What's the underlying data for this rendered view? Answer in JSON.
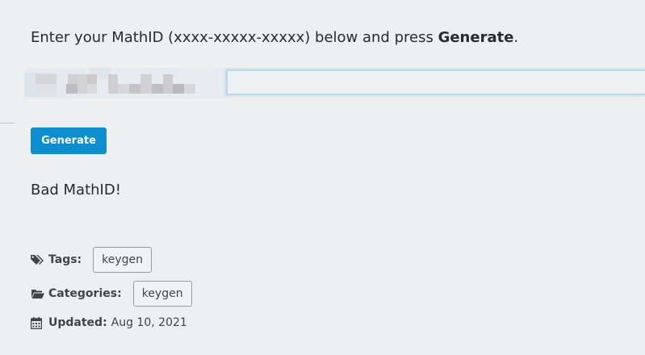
{
  "instruction": {
    "prefix": "Enter your MathID (xxxx-xxxxx-xxxxx) below and press ",
    "emphasis": "Generate",
    "suffix": "."
  },
  "mathid_input": {
    "value": "",
    "placeholder": ""
  },
  "generate_button": {
    "label": "Generate",
    "color": "#0d8fcf"
  },
  "result_message": "Bad MathID!",
  "meta": {
    "tags_label": "Tags:",
    "tags": [
      "keygen"
    ],
    "categories_label": "Categories:",
    "categories": [
      "keygen"
    ],
    "updated_label": "Updated:",
    "updated_value": "Aug 10, 2021"
  },
  "icons": {
    "tags": "tags-icon",
    "categories": "folder-open-icon",
    "updated": "calendar-icon"
  }
}
